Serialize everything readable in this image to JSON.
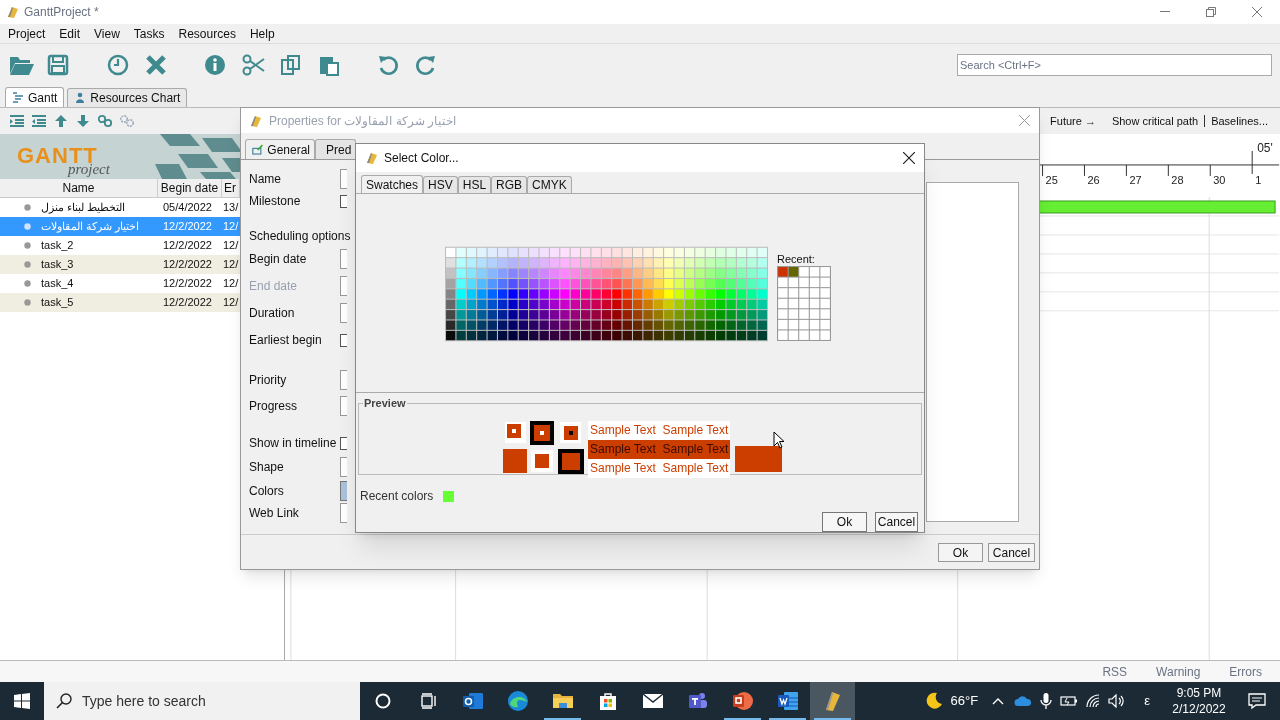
{
  "window": {
    "title": "GanttProject *"
  },
  "menu": [
    "Project",
    "Edit",
    "View",
    "Tasks",
    "Resources",
    "Help"
  ],
  "search": {
    "placeholder": "Search <Ctrl+F>"
  },
  "view_tabs": [
    {
      "label": "Gantt",
      "selected": true
    },
    {
      "label": "Resources Chart",
      "selected": false
    }
  ],
  "logo": {
    "title": "GANTT",
    "subtitle": "project"
  },
  "task_table": {
    "columns": [
      "Name",
      "Begin date",
      "Er"
    ],
    "rows": [
      {
        "name": "التخطيط لبناء منزل",
        "begin": "05/4/2022",
        "end": "13/",
        "selected": false
      },
      {
        "name": "اختيار شركة المقاولات",
        "begin": "12/2/2022",
        "end": "12/",
        "selected": true
      },
      {
        "name": "task_2",
        "begin": "12/2/2022",
        "end": "12/",
        "selected": false
      },
      {
        "name": "task_3",
        "begin": "12/2/2022",
        "end": "12/",
        "selected": false
      },
      {
        "name": "task_4",
        "begin": "12/2/2022",
        "end": "12/",
        "selected": false
      },
      {
        "name": "task_5",
        "begin": "12/2/2022",
        "end": "12/",
        "selected": false
      }
    ]
  },
  "chart": {
    "links": [
      "Future →",
      "Show critical path",
      "Baselines..."
    ],
    "month": "05'",
    "days": [
      "25",
      "26",
      "27",
      "28",
      "30",
      "1"
    ]
  },
  "properties_dialog": {
    "title": "Properties for اختيار شركة المقاولات",
    "tabs": [
      {
        "label": "General",
        "selected": true
      },
      {
        "label": "Pred",
        "selected": false
      }
    ],
    "fields": [
      {
        "label": "Name",
        "kind": "text",
        "disabled": false
      },
      {
        "label": "Milestone",
        "kind": "checkbox",
        "disabled": false,
        "checked": false
      },
      {
        "label": "Scheduling options",
        "kind": "header",
        "disabled": false
      },
      {
        "label": "Begin date",
        "kind": "text",
        "disabled": false
      },
      {
        "label": "End date",
        "kind": "text",
        "disabled": true
      },
      {
        "label": "Duration",
        "kind": "text",
        "disabled": false
      },
      {
        "label": "Earliest begin",
        "kind": "checkbox",
        "disabled": false,
        "checked": false
      },
      {
        "label": "Priority",
        "kind": "text",
        "disabled": false
      },
      {
        "label": "Progress",
        "kind": "text",
        "disabled": false
      },
      {
        "label": "Show in timeline",
        "kind": "checkbox",
        "disabled": false,
        "checked": false
      },
      {
        "label": "Shape",
        "kind": "text",
        "disabled": false
      },
      {
        "label": "Colors",
        "kind": "color",
        "disabled": false
      },
      {
        "label": "Web Link",
        "kind": "text",
        "disabled": false
      }
    ],
    "buttons": [
      "Ok",
      "Cancel"
    ]
  },
  "select_color_dialog": {
    "title": "Select Color...",
    "tabs": [
      {
        "label": "Swatches",
        "selected": true
      },
      {
        "label": "HSV",
        "selected": false
      },
      {
        "label": "HSL",
        "selected": false
      },
      {
        "label": "RGB",
        "selected": false
      },
      {
        "label": "CMYK",
        "selected": false
      }
    ],
    "recent_label": "Recent:",
    "recent": [
      {
        "color": "#cc3300"
      },
      {
        "color": "#666600"
      }
    ],
    "preview": {
      "title": "Preview",
      "color": "#cc3d00",
      "samples": [
        {
          "text": "Sample Text  Sample Text",
          "kind": "plain"
        },
        {
          "text": "Sample Text  Sample Text",
          "kind": "highlighted"
        },
        {
          "text": "Sample Text  Sample Text",
          "kind": "plain"
        }
      ]
    },
    "recent_colors": {
      "label": "Recent colors",
      "swatches": [
        {
          "color": "#66ff33"
        }
      ]
    },
    "buttons": [
      "Ok",
      "Cancel"
    ]
  },
  "status_bar": [
    "RSS",
    "Warning",
    "Errors"
  ],
  "taskbar": {
    "search": {
      "placeholder": "Type here to search"
    },
    "apps": [
      {
        "kind": "cortana",
        "running": false,
        "selected": false
      },
      {
        "kind": "task_view",
        "running": false,
        "selected": false
      },
      {
        "kind": "outlook",
        "running": false,
        "selected": false
      },
      {
        "kind": "edge",
        "running": false,
        "selected": false
      },
      {
        "kind": "explorer",
        "running": true,
        "selected": false
      },
      {
        "kind": "store",
        "running": false,
        "selected": false
      },
      {
        "kind": "mail",
        "running": false,
        "selected": false
      },
      {
        "kind": "teams",
        "running": false,
        "selected": false
      },
      {
        "kind": "powerpoint",
        "running": true,
        "selected": false
      },
      {
        "kind": "word",
        "running": true,
        "selected": false
      },
      {
        "kind": "ganttproject",
        "running": true,
        "selected": true
      }
    ],
    "weather": "66°F",
    "language": "ε",
    "time": "9:05 PM",
    "date": "2/12/2022"
  }
}
